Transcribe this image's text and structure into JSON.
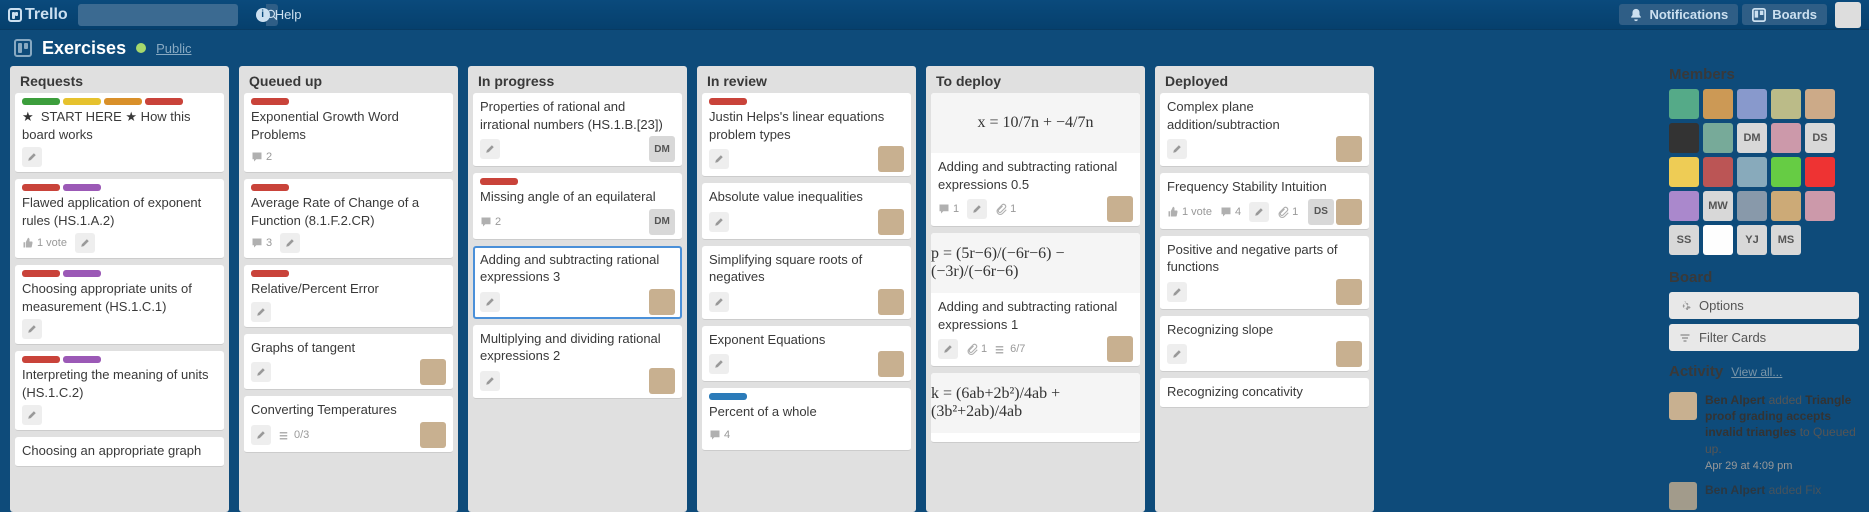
{
  "header": {
    "logo_text": "Trello",
    "search_placeholder": "",
    "help_label": "Help",
    "notifications_label": "Notifications",
    "boards_label": "Boards"
  },
  "board": {
    "title": "Exercises",
    "visibility": "Public"
  },
  "lists": [
    {
      "name": "Requests",
      "cards": [
        {
          "labels": [
            "green",
            "yellow",
            "orange",
            "red"
          ],
          "title_prefix_star": true,
          "title": "START HERE  ★  How this board works",
          "badges": {
            "edit": true
          }
        },
        {
          "labels": [
            "red",
            "purple"
          ],
          "title": "Flawed application of exponent rules (HS.1.A.2)",
          "badges": {
            "vote_text": "1 vote",
            "edit": true
          }
        },
        {
          "labels": [
            "red",
            "purple"
          ],
          "title": "Choosing appropriate units of measurement (HS.1.C.1)",
          "badges": {
            "edit": true
          }
        },
        {
          "labels": [
            "red",
            "purple"
          ],
          "title": "Interpreting the meaning of units (HS.1.C.2)",
          "badges": {
            "edit": true
          }
        },
        {
          "labels": [],
          "title": "Choosing an appropriate graph"
        }
      ]
    },
    {
      "name": "Queued up",
      "cards": [
        {
          "labels": [
            "red"
          ],
          "title": "Exponential Growth Word Problems",
          "badges": {
            "comments": 2
          }
        },
        {
          "labels": [
            "red"
          ],
          "title": "Average Rate of Change of a Function (8.1.F.2.CR)",
          "badges": {
            "comments": 3,
            "edit": true
          }
        },
        {
          "labels": [
            "red"
          ],
          "title": "Relative/Percent Error",
          "badges": {
            "edit": true
          }
        },
        {
          "labels": [],
          "title": "Graphs of tangent",
          "badges": {
            "edit": true
          },
          "members": [
            {
              "type": "avatar"
            }
          ]
        },
        {
          "labels": [],
          "title": "Converting Temperatures",
          "badges": {
            "edit": true,
            "checklist": "0/3"
          },
          "members": [
            {
              "type": "avatar"
            }
          ]
        }
      ]
    },
    {
      "name": "In progress",
      "cards": [
        {
          "labels": [],
          "title": "Properties of rational and irrational numbers (HS.1.B.[23])",
          "badges": {
            "edit": true
          },
          "members": [
            {
              "type": "initials",
              "text": "DM"
            }
          ]
        },
        {
          "labels": [
            "red"
          ],
          "title": "Missing angle of an equilateral",
          "badges": {
            "comments": 2
          },
          "members": [
            {
              "type": "initials",
              "text": "DM"
            }
          ]
        },
        {
          "labels": [],
          "title": "Adding and subtracting rational expressions 3",
          "badges": {
            "edit": true
          },
          "members": [
            {
              "type": "avatar"
            }
          ],
          "selected": true
        },
        {
          "labels": [],
          "title": "Multiplying and dividing rational expressions 2",
          "badges": {
            "edit": true
          },
          "members": [
            {
              "type": "avatar"
            }
          ]
        }
      ]
    },
    {
      "name": "In review",
      "cards": [
        {
          "labels": [
            "red"
          ],
          "title": "Justin Helps's linear equations problem types",
          "badges": {
            "edit": true
          },
          "members": [
            {
              "type": "avatar"
            }
          ]
        },
        {
          "labels": [],
          "title": "Absolute value inequalities",
          "badges": {
            "edit": true
          },
          "members": [
            {
              "type": "avatar"
            }
          ]
        },
        {
          "labels": [],
          "title": "Simplifying square roots of negatives",
          "badges": {
            "edit": true
          },
          "members": [
            {
              "type": "avatar"
            }
          ]
        },
        {
          "labels": [],
          "title": "Exponent Equations",
          "badges": {
            "edit": true
          },
          "members": [
            {
              "type": "avatar"
            }
          ]
        },
        {
          "labels": [
            "blue"
          ],
          "title": "Percent of a whole",
          "badges": {
            "comments": 4
          }
        }
      ]
    },
    {
      "name": "To deploy",
      "cards": [
        {
          "image_formula": "x = 10/7n + −4/7n",
          "title": "Adding and subtracting rational expressions 0.5",
          "badges": {
            "comments": 1,
            "edit": true,
            "attachments": 1
          },
          "members": [
            {
              "type": "avatar"
            }
          ]
        },
        {
          "image_formula": "p = (5r−6)/(−6r−6) − (−3r)/(−6r−6)",
          "title": "Adding and subtracting rational expressions 1",
          "badges": {
            "edit": true,
            "attachments": 1,
            "checklist": "6/7"
          },
          "members": [
            {
              "type": "avatar"
            }
          ]
        },
        {
          "image_formula": "k = (6ab+2b²)/4ab + (3b²+2ab)/4ab"
        }
      ]
    },
    {
      "name": "Deployed",
      "cards": [
        {
          "labels": [],
          "title": "Complex plane addition/subtraction",
          "badges": {
            "edit": true
          },
          "members": [
            {
              "type": "avatar"
            }
          ]
        },
        {
          "labels": [],
          "title": "Frequency Stability Intuition",
          "badges": {
            "vote_text": "1 vote",
            "comments": 4,
            "edit": true,
            "attachments": 1
          },
          "members": [
            {
              "type": "initials",
              "text": "DS"
            },
            {
              "type": "avatar"
            }
          ]
        },
        {
          "labels": [],
          "title": "Positive and negative parts of functions",
          "badges": {
            "edit": true
          },
          "members": [
            {
              "type": "avatar"
            }
          ]
        },
        {
          "labels": [],
          "title": "Recognizing slope",
          "badges": {
            "edit": true
          },
          "members": [
            {
              "type": "avatar"
            }
          ]
        },
        {
          "labels": [],
          "title": "Recognizing concativity"
        }
      ]
    }
  ],
  "sidebar": {
    "members_title": "Members",
    "members": [
      {
        "type": "avatar",
        "bg": "#5a8"
      },
      {
        "type": "avatar",
        "bg": "#c95"
      },
      {
        "type": "avatar",
        "bg": "#89c"
      },
      {
        "type": "avatar",
        "bg": "#bb8"
      },
      {
        "type": "avatar",
        "bg": "#ca8"
      },
      {
        "type": "avatar",
        "bg": "#333"
      },
      {
        "type": "avatar",
        "bg": "#7a9"
      },
      {
        "type": "initials",
        "text": "DM"
      },
      {
        "type": "avatar",
        "bg": "#c9a"
      },
      {
        "type": "initials",
        "text": "DS"
      },
      {
        "type": "avatar",
        "bg": "#ec5"
      },
      {
        "type": "avatar",
        "bg": "#b55"
      },
      {
        "type": "avatar",
        "bg": "#8ab"
      },
      {
        "type": "avatar",
        "bg": "#6c4"
      },
      {
        "type": "avatar",
        "bg": "#e33"
      },
      {
        "type": "avatar",
        "bg": "#a8c"
      },
      {
        "type": "initials",
        "text": "MW"
      },
      {
        "type": "avatar",
        "bg": "#89a"
      },
      {
        "type": "avatar",
        "bg": "#ca7"
      },
      {
        "type": "avatar",
        "bg": "#c9a"
      },
      {
        "type": "initials",
        "text": "SS"
      },
      {
        "type": "avatar",
        "bg": "#fefefe"
      },
      {
        "type": "initials",
        "text": "YJ"
      },
      {
        "type": "initials",
        "text": "MS"
      }
    ],
    "board_section_title": "Board",
    "options_label": "Options",
    "filter_label": "Filter Cards",
    "activity_title": "Activity",
    "view_all_label": "View all...",
    "activity": {
      "actor": "Ben Alpert",
      "verb": " added ",
      "object": "Triangle proof grading accepts invalid triangles",
      "suffix": " to Queued up.",
      "time": "Apr 29 at 4:09 pm"
    },
    "activity2_prefix": "Ben Alpert",
    "activity2_suffix": " added Fix"
  }
}
